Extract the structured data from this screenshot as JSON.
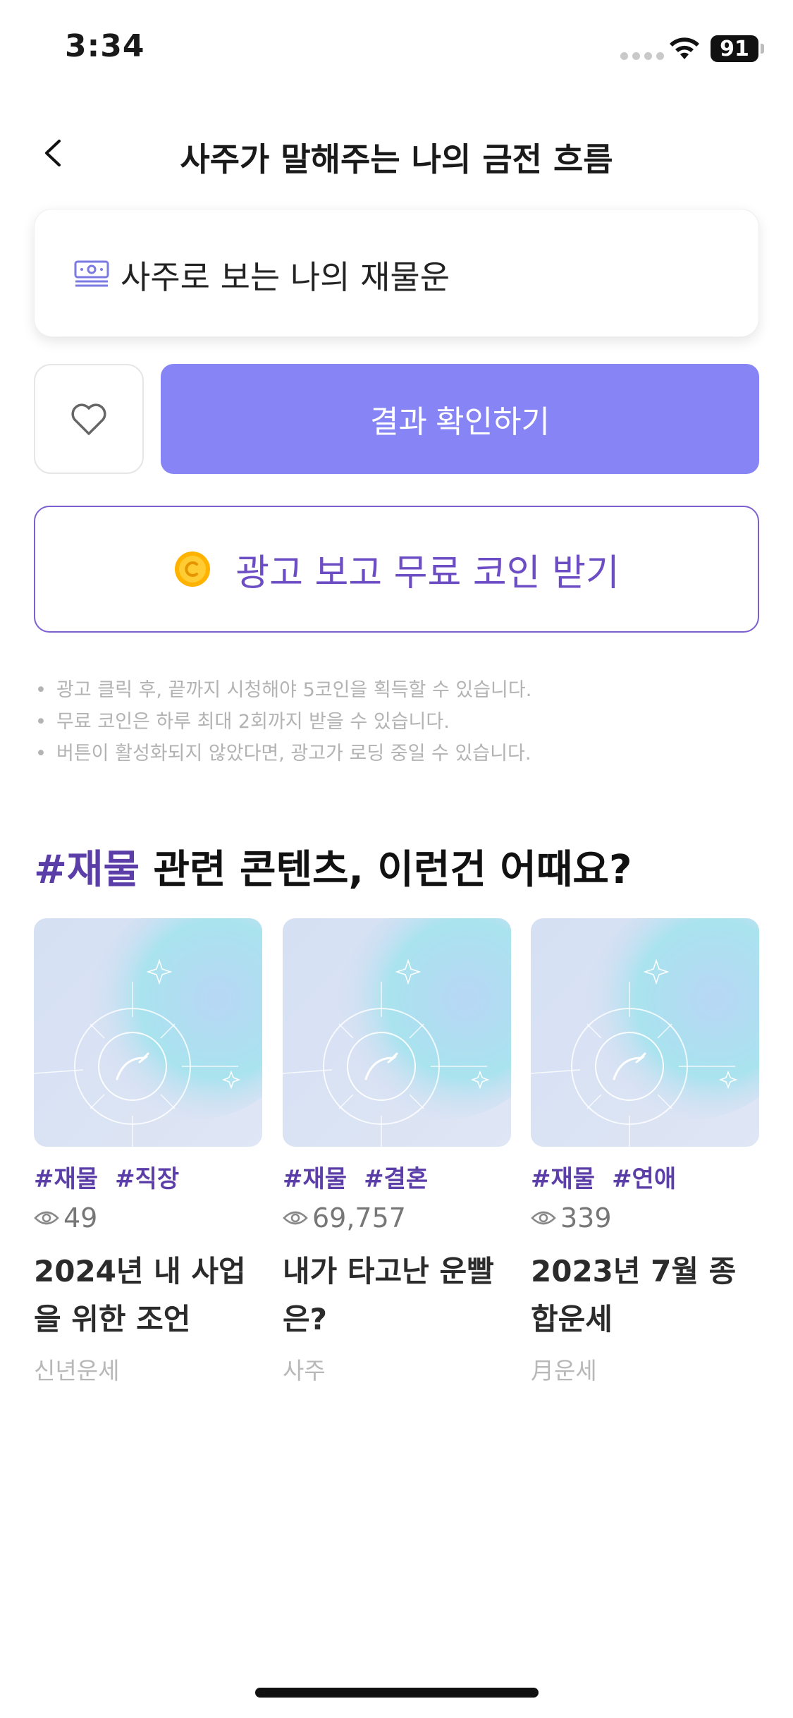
{
  "status_bar": {
    "time": "3:34",
    "battery": "91"
  },
  "nav": {
    "title": "사주가 말해주는 나의 금전 흐름"
  },
  "product": {
    "title": "사주로 보는 나의 재물운",
    "icon": "money-icon"
  },
  "actions": {
    "result_label": "결과 확인하기",
    "ad_label": "광고 보고 무료 코인 받기"
  },
  "notices": [
    "광고 클릭 후, 끝까지 시청해야 5코인을 획득할 수 있습니다.",
    "무료 코인은 하루 최대 2회까지 받을 수 있습니다.",
    "버튼이 활성화되지 않았다면, 광고가 로딩 중일 수 있습니다."
  ],
  "related": {
    "hash": "#재물",
    "title_rest": " 관련 콘텐츠, 이런건 어때요?",
    "cards": [
      {
        "tags": [
          "#재물",
          "#직장"
        ],
        "views": "49",
        "title": "2024년 내 사업을 위한 조언",
        "category": "신년운세"
      },
      {
        "tags": [
          "#재물",
          "#결혼"
        ],
        "views": "69,757",
        "title": "내가 타고난 운빨은?",
        "category": "사주"
      },
      {
        "tags": [
          "#재물",
          "#연애"
        ],
        "views": "339",
        "title": "2023년 7월 종합운세",
        "category": "月운세"
      }
    ]
  },
  "colors": {
    "accent": "#8785f6",
    "tag": "#5b3ea8",
    "ad_border": "#7d5fd0"
  }
}
